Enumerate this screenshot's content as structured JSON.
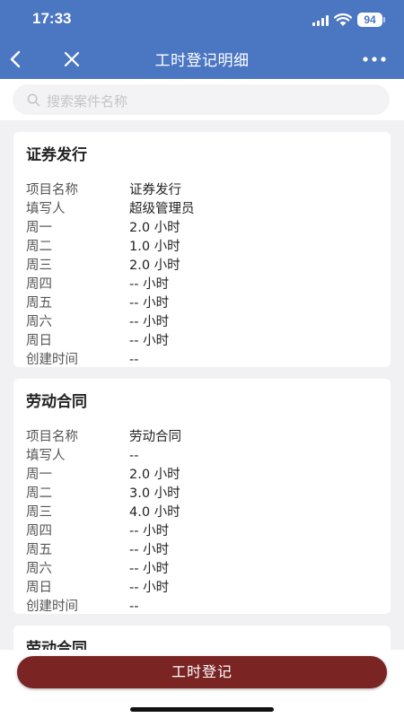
{
  "status_bar": {
    "time": "17:33",
    "battery": "94"
  },
  "nav": {
    "title": "工时登记明细",
    "back_icon": "chevron-left-icon",
    "close_icon": "close-icon",
    "more_icon": "more-horizontal-icon"
  },
  "search": {
    "placeholder": "搜索案件名称",
    "icon": "search-icon"
  },
  "cards": [
    {
      "title": "证券发行",
      "rows": [
        {
          "key": "项目名称",
          "value": "证券发行"
        },
        {
          "key": "填写人",
          "value": "超级管理员"
        },
        {
          "key": "周一",
          "value": "2.0 小时"
        },
        {
          "key": "周二",
          "value": "1.0 小时"
        },
        {
          "key": "周三",
          "value": "2.0 小时"
        },
        {
          "key": "周四",
          "value": "-- 小时"
        },
        {
          "key": "周五",
          "value": "-- 小时"
        },
        {
          "key": "周六",
          "value": "-- 小时"
        },
        {
          "key": "周日",
          "value": "-- 小时"
        },
        {
          "key": "创建时间",
          "value": "--"
        }
      ]
    },
    {
      "title": "劳动合同",
      "rows": [
        {
          "key": "项目名称",
          "value": "劳动合同"
        },
        {
          "key": "填写人",
          "value": "--"
        },
        {
          "key": "周一",
          "value": "2.0 小时"
        },
        {
          "key": "周二",
          "value": "3.0 小时"
        },
        {
          "key": "周三",
          "value": "4.0 小时"
        },
        {
          "key": "周四",
          "value": "-- 小时"
        },
        {
          "key": "周五",
          "value": "-- 小时"
        },
        {
          "key": "周六",
          "value": "-- 小时"
        },
        {
          "key": "周日",
          "value": "-- 小时"
        },
        {
          "key": "创建时间",
          "value": "--"
        }
      ]
    },
    {
      "title": "劳动合同",
      "rows": []
    }
  ],
  "bottom": {
    "register_label": "工时登记"
  },
  "colors": {
    "header": "#4b76c2",
    "button": "#7a2424",
    "background": "#f1f1f3"
  }
}
